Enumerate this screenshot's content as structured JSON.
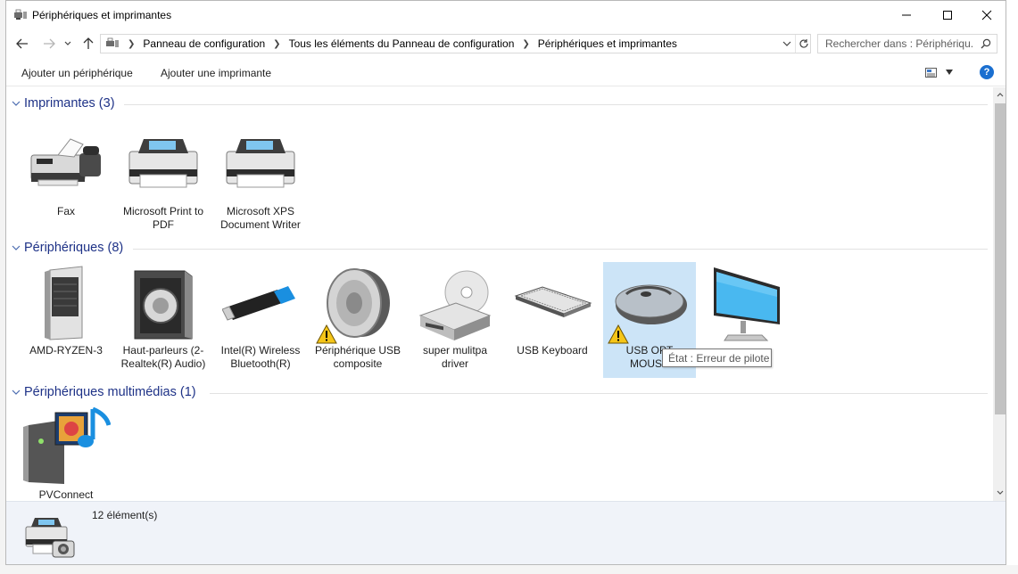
{
  "window": {
    "title": "Périphériques et imprimantes"
  },
  "address": {
    "crumbs": [
      "Panneau de configuration",
      "Tous les éléments du Panneau de configuration",
      "Périphériques et imprimantes"
    ],
    "search_placeholder": "Rechercher dans : Périphériqu..."
  },
  "commands": {
    "add_device": "Ajouter un périphérique",
    "add_printer": "Ajouter une imprimante",
    "help": "?"
  },
  "groups": {
    "printers": {
      "title": "Imprimantes (3)",
      "items": [
        {
          "label": "Fax",
          "icon": "fax-icon"
        },
        {
          "label": "Microsoft Print to PDF",
          "icon": "printer-icon"
        },
        {
          "label": "Microsoft XPS Document Writer",
          "icon": "printer-icon"
        }
      ]
    },
    "devices": {
      "title": "Périphériques (8)",
      "items": [
        {
          "label": "AMD-RYZEN-3",
          "icon": "computer-tower-icon",
          "warning": false
        },
        {
          "label": "Haut-parleurs (2-Realtek(R) Audio)",
          "icon": "speaker-icon",
          "warning": false
        },
        {
          "label": "Intel(R) Wireless Bluetooth(R)",
          "icon": "usb-dongle-icon",
          "warning": false
        },
        {
          "label": "Périphérique USB composite",
          "icon": "loudspeaker-icon",
          "warning": true
        },
        {
          "label": "super mulitpa driver",
          "icon": "cd-drive-icon",
          "warning": false
        },
        {
          "label": "USB Keyboard",
          "icon": "keyboard-icon",
          "warning": false
        },
        {
          "label": "USB OPT... MOUSE",
          "label_line1": "USB OPT",
          "label_line2": "MOUSE",
          "icon": "mouse-icon",
          "warning": true,
          "selected": true
        },
        {
          "label": "",
          "icon": "monitor-icon",
          "warning": false
        }
      ]
    },
    "multimedia": {
      "title": "Périphériques multimédias (1)",
      "items": [
        {
          "label": "PVConnect",
          "icon": "media-server-icon"
        }
      ]
    }
  },
  "tooltip": {
    "text": "État : Erreur de pilote"
  },
  "details": {
    "count": "12 élément(s)"
  },
  "colors": {
    "group_title": "#1e3287",
    "selection": "#cce4f7",
    "help_blue": "#1a6fd0",
    "warning_yellow": "#f5c518"
  }
}
